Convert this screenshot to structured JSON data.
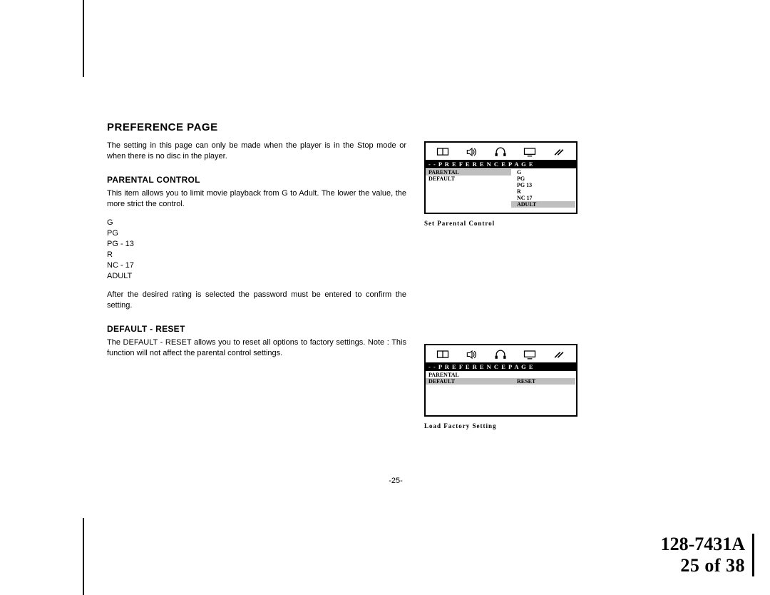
{
  "heading": "PREFERENCE PAGE",
  "intro": "The setting in this page can only be made when the player is in the Stop mode or when there is no disc in the player.",
  "section1": {
    "title": "PARENTAL CONTROL",
    "para1": "This item allows you to limit movie playback from G to Adult. The lower the value, the more strict the control.",
    "ratings": [
      "G",
      "PG",
      "PG - 13",
      "R",
      "NC - 17",
      "ADULT"
    ],
    "para2": "After the desired rating is selected the password must be entered to confirm the setting."
  },
  "section2": {
    "title": "DEFAULT - RESET",
    "para": "The DEFAULT - RESET allows you to reset all options to factory settings. Note : This function will not affect the parental control settings."
  },
  "page_number": "-25-",
  "doc_id_line1": "128-7431A",
  "doc_id_line2": "25 of  38",
  "osd1": {
    "title": "- -   P R E F E R E N C E    P A G E",
    "left": [
      "PARENTAL",
      "DEFAULT"
    ],
    "right": [
      "G",
      "PG",
      "PG 13",
      "R",
      "NC 17",
      "ADULT"
    ],
    "left_hl_index": 0,
    "right_hl_index": 5,
    "caption": "Set   Parental   Control"
  },
  "osd2": {
    "title": "- -   P R E F E R E N C E    P A G E",
    "left": [
      "PARENTAL",
      "DEFAULT"
    ],
    "right": [
      "RESET"
    ],
    "left_hl_index": 1,
    "right_hl_index": 0,
    "caption": "Load   Factory   Setting"
  }
}
